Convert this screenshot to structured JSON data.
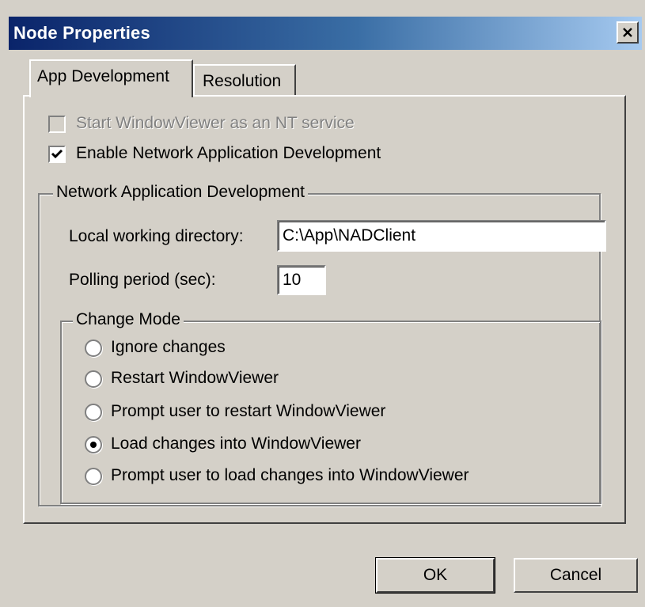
{
  "window": {
    "title": "Node Properties",
    "close_glyph": "✕"
  },
  "tabs": [
    {
      "label": "App Development",
      "active": true
    },
    {
      "label": "Resolution",
      "active": false
    }
  ],
  "options": {
    "nt_service": {
      "label": "Start WindowViewer as an NT service",
      "checked": false,
      "enabled": false
    },
    "enable_nad": {
      "label": "Enable Network Application Development",
      "checked": true,
      "enabled": true
    }
  },
  "nad_group": {
    "title": "Network Application Development",
    "local_dir_label": "Local working directory:",
    "local_dir_value": "C:\\App\\NADClient",
    "polling_label": "Polling period (sec):",
    "polling_value": "10"
  },
  "change_mode": {
    "title": "Change Mode",
    "options": [
      {
        "label": "Ignore changes",
        "selected": false
      },
      {
        "label": "Restart WindowViewer",
        "selected": false
      },
      {
        "label": "Prompt user to restart WindowViewer",
        "selected": false
      },
      {
        "label": "Load changes into WindowViewer",
        "selected": true
      },
      {
        "label": "Prompt user to load changes into WindowViewer",
        "selected": false
      }
    ]
  },
  "buttons": {
    "ok": "OK",
    "cancel": "Cancel"
  },
  "colors": {
    "dialog_face": "#d4d0c8",
    "titlebar_start": "#0a246a",
    "titlebar_end": "#a6caf0",
    "disabled_text": "#808080"
  }
}
